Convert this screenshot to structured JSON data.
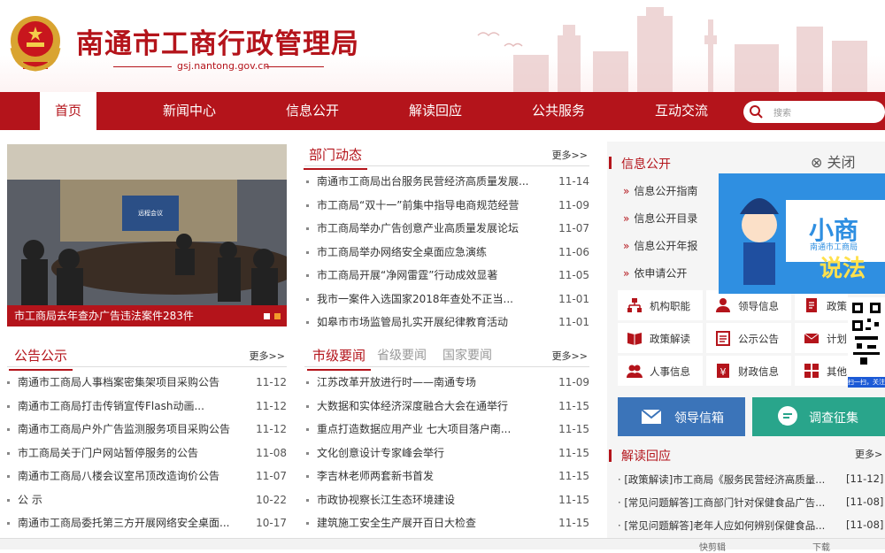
{
  "header": {
    "title": "南通市工商行政管理局",
    "domain": "gsj.nantong.gov.cn"
  },
  "nav": {
    "items": [
      "首页",
      "新闻中心",
      "信息公开",
      "解读回应",
      "公共服务",
      "互动交流"
    ],
    "search_placeholder": "搜索"
  },
  "banner": {
    "caption": "市工商局去年查办广告违法案件283件",
    "screen_text": "远程会议"
  },
  "dept_news": {
    "title": "部门动态",
    "more": "更多>>",
    "items": [
      {
        "t": "南通市工商局出台服务民营经济高质量发展...",
        "d": "11-14"
      },
      {
        "t": "市工商局“双十一”前集中指导电商规范经营",
        "d": "11-09"
      },
      {
        "t": "市工商局举办广告创意产业高质量发展论坛",
        "d": "11-07"
      },
      {
        "t": "市工商局举办网络安全桌面应急演练",
        "d": "11-06"
      },
      {
        "t": "市工商局开展“净网雷霆”行动成效显著",
        "d": "11-05"
      },
      {
        "t": "我市一案件入选国家2018年查处不正当...",
        "d": "11-01"
      },
      {
        "t": "如皋市市场监管局扎实开展纪律教育活动",
        "d": "11-01"
      }
    ]
  },
  "notices": {
    "title": "公告公示",
    "more": "更多>>",
    "items": [
      {
        "t": "南通市工商局人事档案密集架项目采购公告",
        "d": "11-12"
      },
      {
        "t": "南通市工商局打击传销宣传Flash动画...",
        "d": "11-12"
      },
      {
        "t": "南通市工商局户外广告监测服务项目采购公告",
        "d": "11-12"
      },
      {
        "t": "市工商局关于门户网站暂停服务的公告",
        "d": "11-08"
      },
      {
        "t": "南通市工商局八楼会议室吊顶改造询价公告",
        "d": "11-07"
      },
      {
        "t": "公 示",
        "d": "10-22"
      },
      {
        "t": "南通市工商局委托第三方开展网络安全桌面...",
        "d": "10-17"
      }
    ]
  },
  "city_news": {
    "tabs": [
      "市级要闻",
      "省级要闻",
      "国家要闻"
    ],
    "more": "更多>>",
    "items": [
      {
        "t": "江苏改革开放进行时——南通专场",
        "d": "11-09"
      },
      {
        "t": "大数据和实体经济深度融合大会在通举行",
        "d": "11-15"
      },
      {
        "t": "重点打造数据应用产业 七大项目落户南...",
        "d": "11-15"
      },
      {
        "t": "文化创意设计专家峰会举行",
        "d": "11-15"
      },
      {
        "t": "李吉林老师两套新书首发",
        "d": "11-15"
      },
      {
        "t": "市政协视察长江生态环境建设",
        "d": "11-15"
      },
      {
        "t": "建筑施工安全生产展开百日大检查",
        "d": "11-15"
      }
    ]
  },
  "info_open": {
    "title": "信息公开",
    "links": [
      "信息公开指南",
      "信息公开目录",
      "信息公开年报",
      "依申请公开"
    ],
    "tiles": [
      "机构职能",
      "领导信息",
      "政策",
      "政策解读",
      "公示公告",
      "计划",
      "人事信息",
      "财政信息",
      "其他"
    ]
  },
  "ad": {
    "close": "关闭",
    "text_big1": "小商",
    "text_big2": "说法",
    "text_small": "南通市工商局",
    "qr_caption": "扫一扫，关注我们"
  },
  "buttons": {
    "mail": "领导信箱",
    "survey": "调查征集"
  },
  "reading": {
    "title": "解读回应",
    "more": "更多>",
    "items": [
      {
        "t": "[政策解读]市工商局《服务民营经济高质量...",
        "d": "[11-12]"
      },
      {
        "t": "[常见问题解答]工商部门针对保健食品广告...",
        "d": "[11-08]"
      },
      {
        "t": "[常见问题解答]老年人应如何辨别保健食品...",
        "d": "[11-08]"
      }
    ]
  },
  "footer": {
    "items": [
      "快剪辑",
      "下载"
    ]
  },
  "colors": {
    "brand": "#b4141b",
    "mail": "#3b74b9",
    "survey": "#29a58b"
  }
}
